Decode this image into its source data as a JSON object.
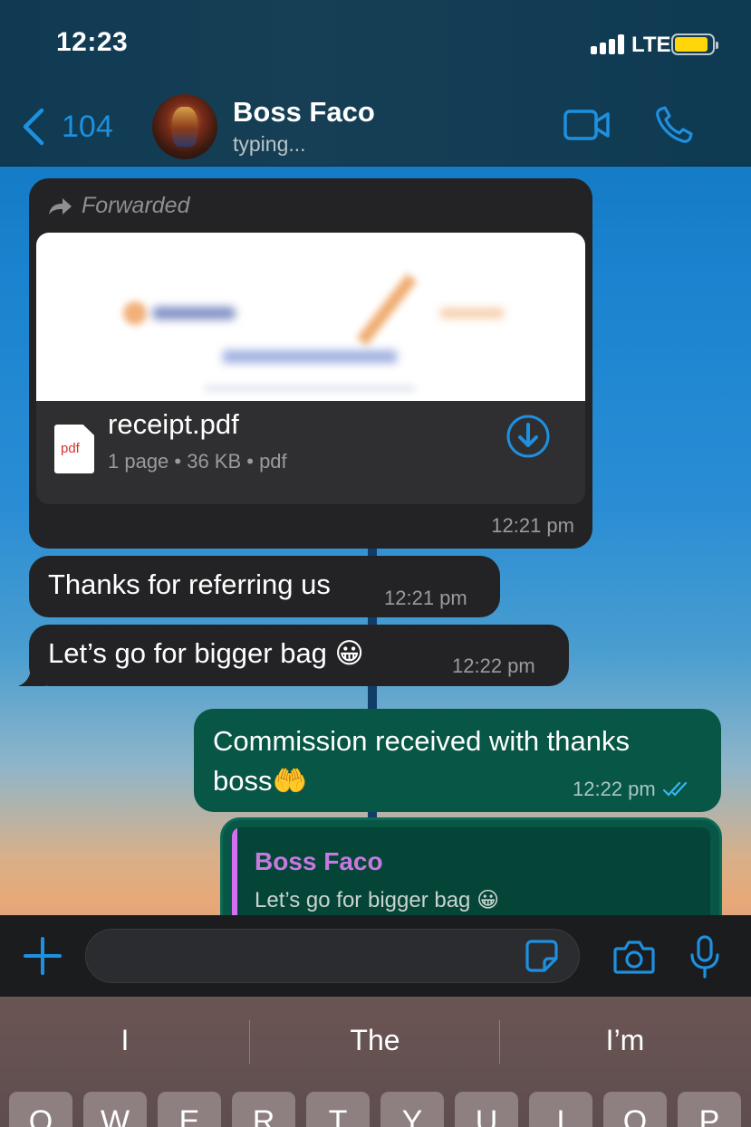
{
  "status_bar": {
    "time": "12:23",
    "network": "LTE"
  },
  "header": {
    "back_count": "104",
    "contact_name": "Boss Faco",
    "contact_status": "typing..."
  },
  "messages": [
    {
      "type": "document",
      "direction": "incoming",
      "forwarded_label": "Forwarded",
      "file_icon_label": "pdf",
      "file_name": "receipt.pdf",
      "file_meta": "1 page • 36 KB • pdf",
      "time": "12:21 pm"
    },
    {
      "type": "text",
      "direction": "incoming",
      "text": "Thanks for referring us",
      "time": "12:21 pm"
    },
    {
      "type": "text",
      "direction": "incoming",
      "text": "Let’s go for bigger bag 😀",
      "time": "12:22 pm"
    },
    {
      "type": "text",
      "direction": "outgoing",
      "text": "Commission received with thanks boss🤲",
      "time": "12:22 pm",
      "read": true
    },
    {
      "type": "reply",
      "direction": "outgoing",
      "quote_author": "Boss Faco",
      "quote_text": "Let’s go for bigger bag 😀"
    }
  ],
  "composer": {
    "placeholder": ""
  },
  "keyboard": {
    "suggestions": [
      "I",
      "The",
      "I’m"
    ],
    "top_row": [
      "Q",
      "W",
      "E",
      "R",
      "T",
      "Y",
      "U",
      "I",
      "O",
      "P"
    ]
  },
  "colors": {
    "accent": "#1e90e0",
    "incoming_bubble": "#232325",
    "outgoing_bubble": "#075646",
    "quote_author": "#c57ae0"
  }
}
